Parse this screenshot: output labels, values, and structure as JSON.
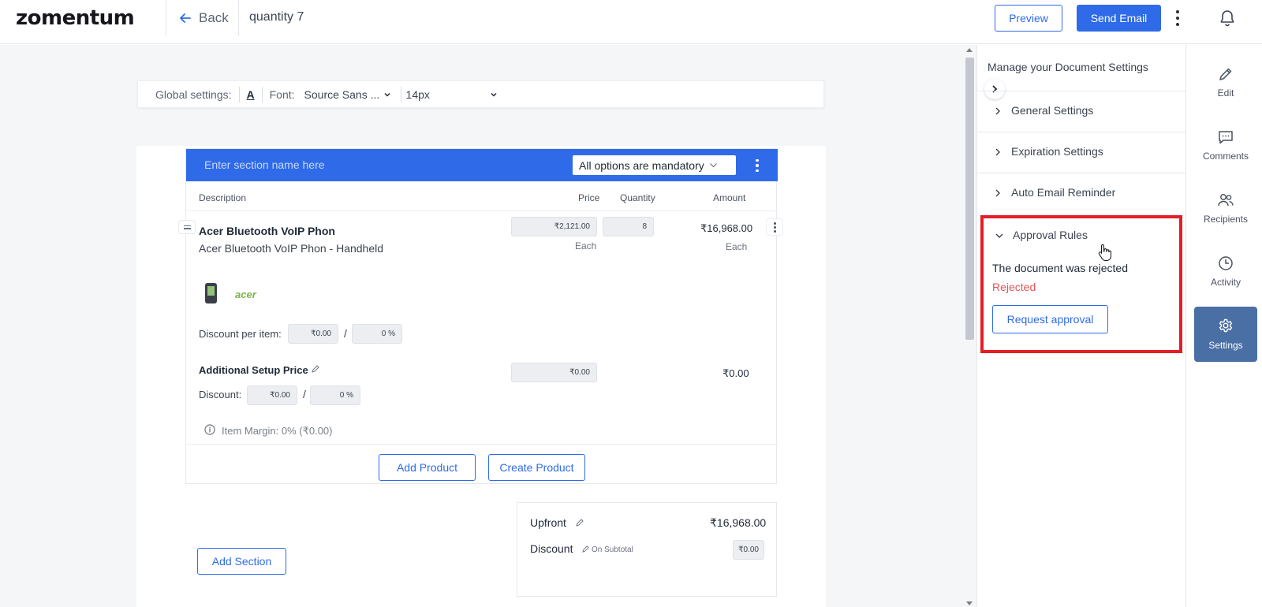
{
  "header": {
    "logo": "zomentum",
    "back_label": "Back",
    "doc_title": "quantity 7",
    "preview_label": "Preview",
    "send_label": "Send Email"
  },
  "global_settings": {
    "label": "Global settings:",
    "text_color_glyph": "A",
    "font_label": "Font:",
    "font_value": "Source Sans ...",
    "size_value": "14px"
  },
  "section": {
    "name_placeholder": "Enter section name here",
    "option_select": "All options are mandatory",
    "columns": [
      "Description",
      "Price",
      "Quantity",
      "Amount"
    ],
    "product": {
      "name": "Acer Bluetooth VoIP Phon",
      "description": "Acer Bluetooth VoIP Phon - Handheld",
      "price": "₹2,121.00",
      "price_unit": "Each",
      "quantity": "8",
      "amount": "₹16,968.00",
      "amount_unit": "Each",
      "brand": "acer",
      "discount_label": "Discount per item:",
      "discount_amount": "₹0.00",
      "discount_percent": "0 %",
      "setup_label": "Additional Setup Price",
      "setup_price": "₹0.00",
      "setup_amount": "₹0.00",
      "setup_discount_label": "Discount:",
      "setup_discount_amount": "₹0.00",
      "setup_discount_percent": "0 %",
      "margin": "Item Margin: 0% (₹0.00)"
    },
    "add_product_label": "Add Product",
    "create_product_label": "Create Product",
    "add_section_label": "Add Section"
  },
  "totals": {
    "upfront_label": "Upfront",
    "upfront_value": "₹16,968.00",
    "discount_label": "Discount",
    "discount_sub": "On Subtotal",
    "discount_value": "₹0.00"
  },
  "panel": {
    "title": "Manage your Document Settings",
    "accordions": [
      "General Settings",
      "Expiration Settings",
      "Auto Email Reminder"
    ],
    "approval": {
      "title": "Approval Rules",
      "message": "The document was rejected",
      "status": "Rejected",
      "status_color": "#e55353",
      "request_label": "Request approval"
    }
  },
  "rail": {
    "items": [
      {
        "label": "Edit",
        "icon": "pencil-icon"
      },
      {
        "label": "Comments",
        "icon": "comment-icon"
      },
      {
        "label": "Recipients",
        "icon": "users-icon"
      },
      {
        "label": "Activity",
        "icon": "clock-icon"
      },
      {
        "label": "Settings",
        "icon": "gear-icon",
        "active": true
      }
    ]
  },
  "colors": {
    "primary": "#2f6be8",
    "highlight_border": "#e31e24",
    "rail_active": "#4a6fa5"
  }
}
